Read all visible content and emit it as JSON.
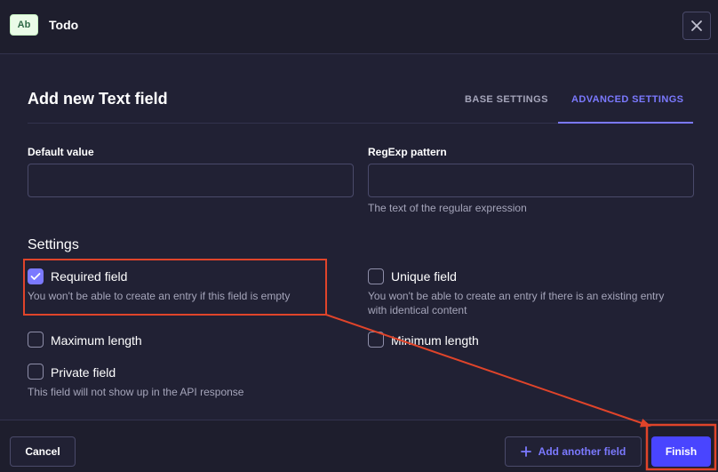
{
  "header": {
    "type_badge": "Ab",
    "collection_name": "Todo"
  },
  "modal": {
    "title": "Add new Text field",
    "tabs": [
      {
        "label": "BASE SETTINGS",
        "active": false
      },
      {
        "label": "ADVANCED SETTINGS",
        "active": true
      }
    ],
    "default_value": {
      "label": "Default value",
      "value": ""
    },
    "regexp": {
      "label": "RegExp pattern",
      "value": "",
      "hint": "The text of the regular expression"
    },
    "settings_heading": "Settings",
    "settings": {
      "required": {
        "label": "Required field",
        "checked": true,
        "hint": "You won't be able to create an entry if this field is empty"
      },
      "unique": {
        "label": "Unique field",
        "checked": false,
        "hint_line1": "You won't be able to create an entry if there is an existing entry",
        "hint_line2": "with identical content"
      },
      "max_length": {
        "label": "Maximum length",
        "checked": false
      },
      "min_length": {
        "label": "Minimum length",
        "checked": false
      },
      "private": {
        "label": "Private field",
        "checked": false,
        "hint": "This field will not show up in the API response"
      }
    }
  },
  "footer": {
    "cancel_label": "Cancel",
    "add_another_label": "Add another field",
    "finish_label": "Finish"
  },
  "colors": {
    "accent": "#7b79ff",
    "primary_button": "#4945ff",
    "annotation": "#e0442a"
  }
}
